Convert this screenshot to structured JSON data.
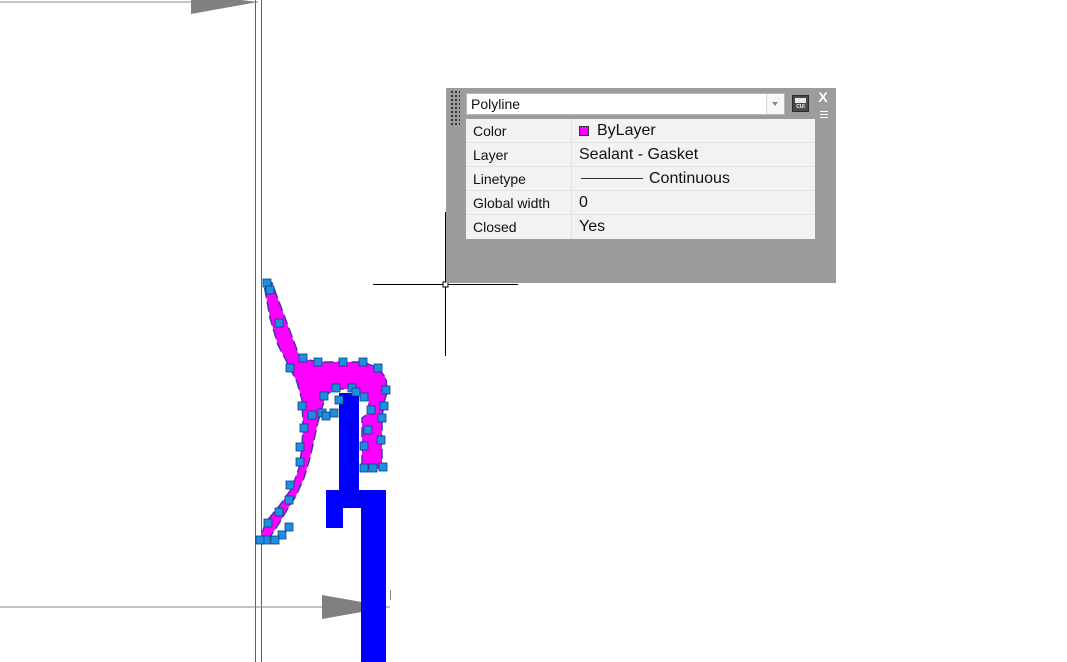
{
  "quick_properties": {
    "object_type": "Polyline",
    "close_glyph": "X",
    "cui_label": "CUI",
    "properties": [
      {
        "name": "Color",
        "value": "ByLayer",
        "swatch": "#ff00ff"
      },
      {
        "name": "Layer",
        "value": "Sealant - Gasket"
      },
      {
        "name": "Linetype",
        "value": "Continuous"
      },
      {
        "name": "Global width",
        "value": "0"
      },
      {
        "name": "Closed",
        "value": "Yes"
      }
    ]
  },
  "colors": {
    "gasket_fill": "#ff00ff",
    "profile_fill": "#0000ff",
    "grip": "#1e8fe0",
    "dimension": "#8a8a8a",
    "crosshair": "#000000"
  }
}
